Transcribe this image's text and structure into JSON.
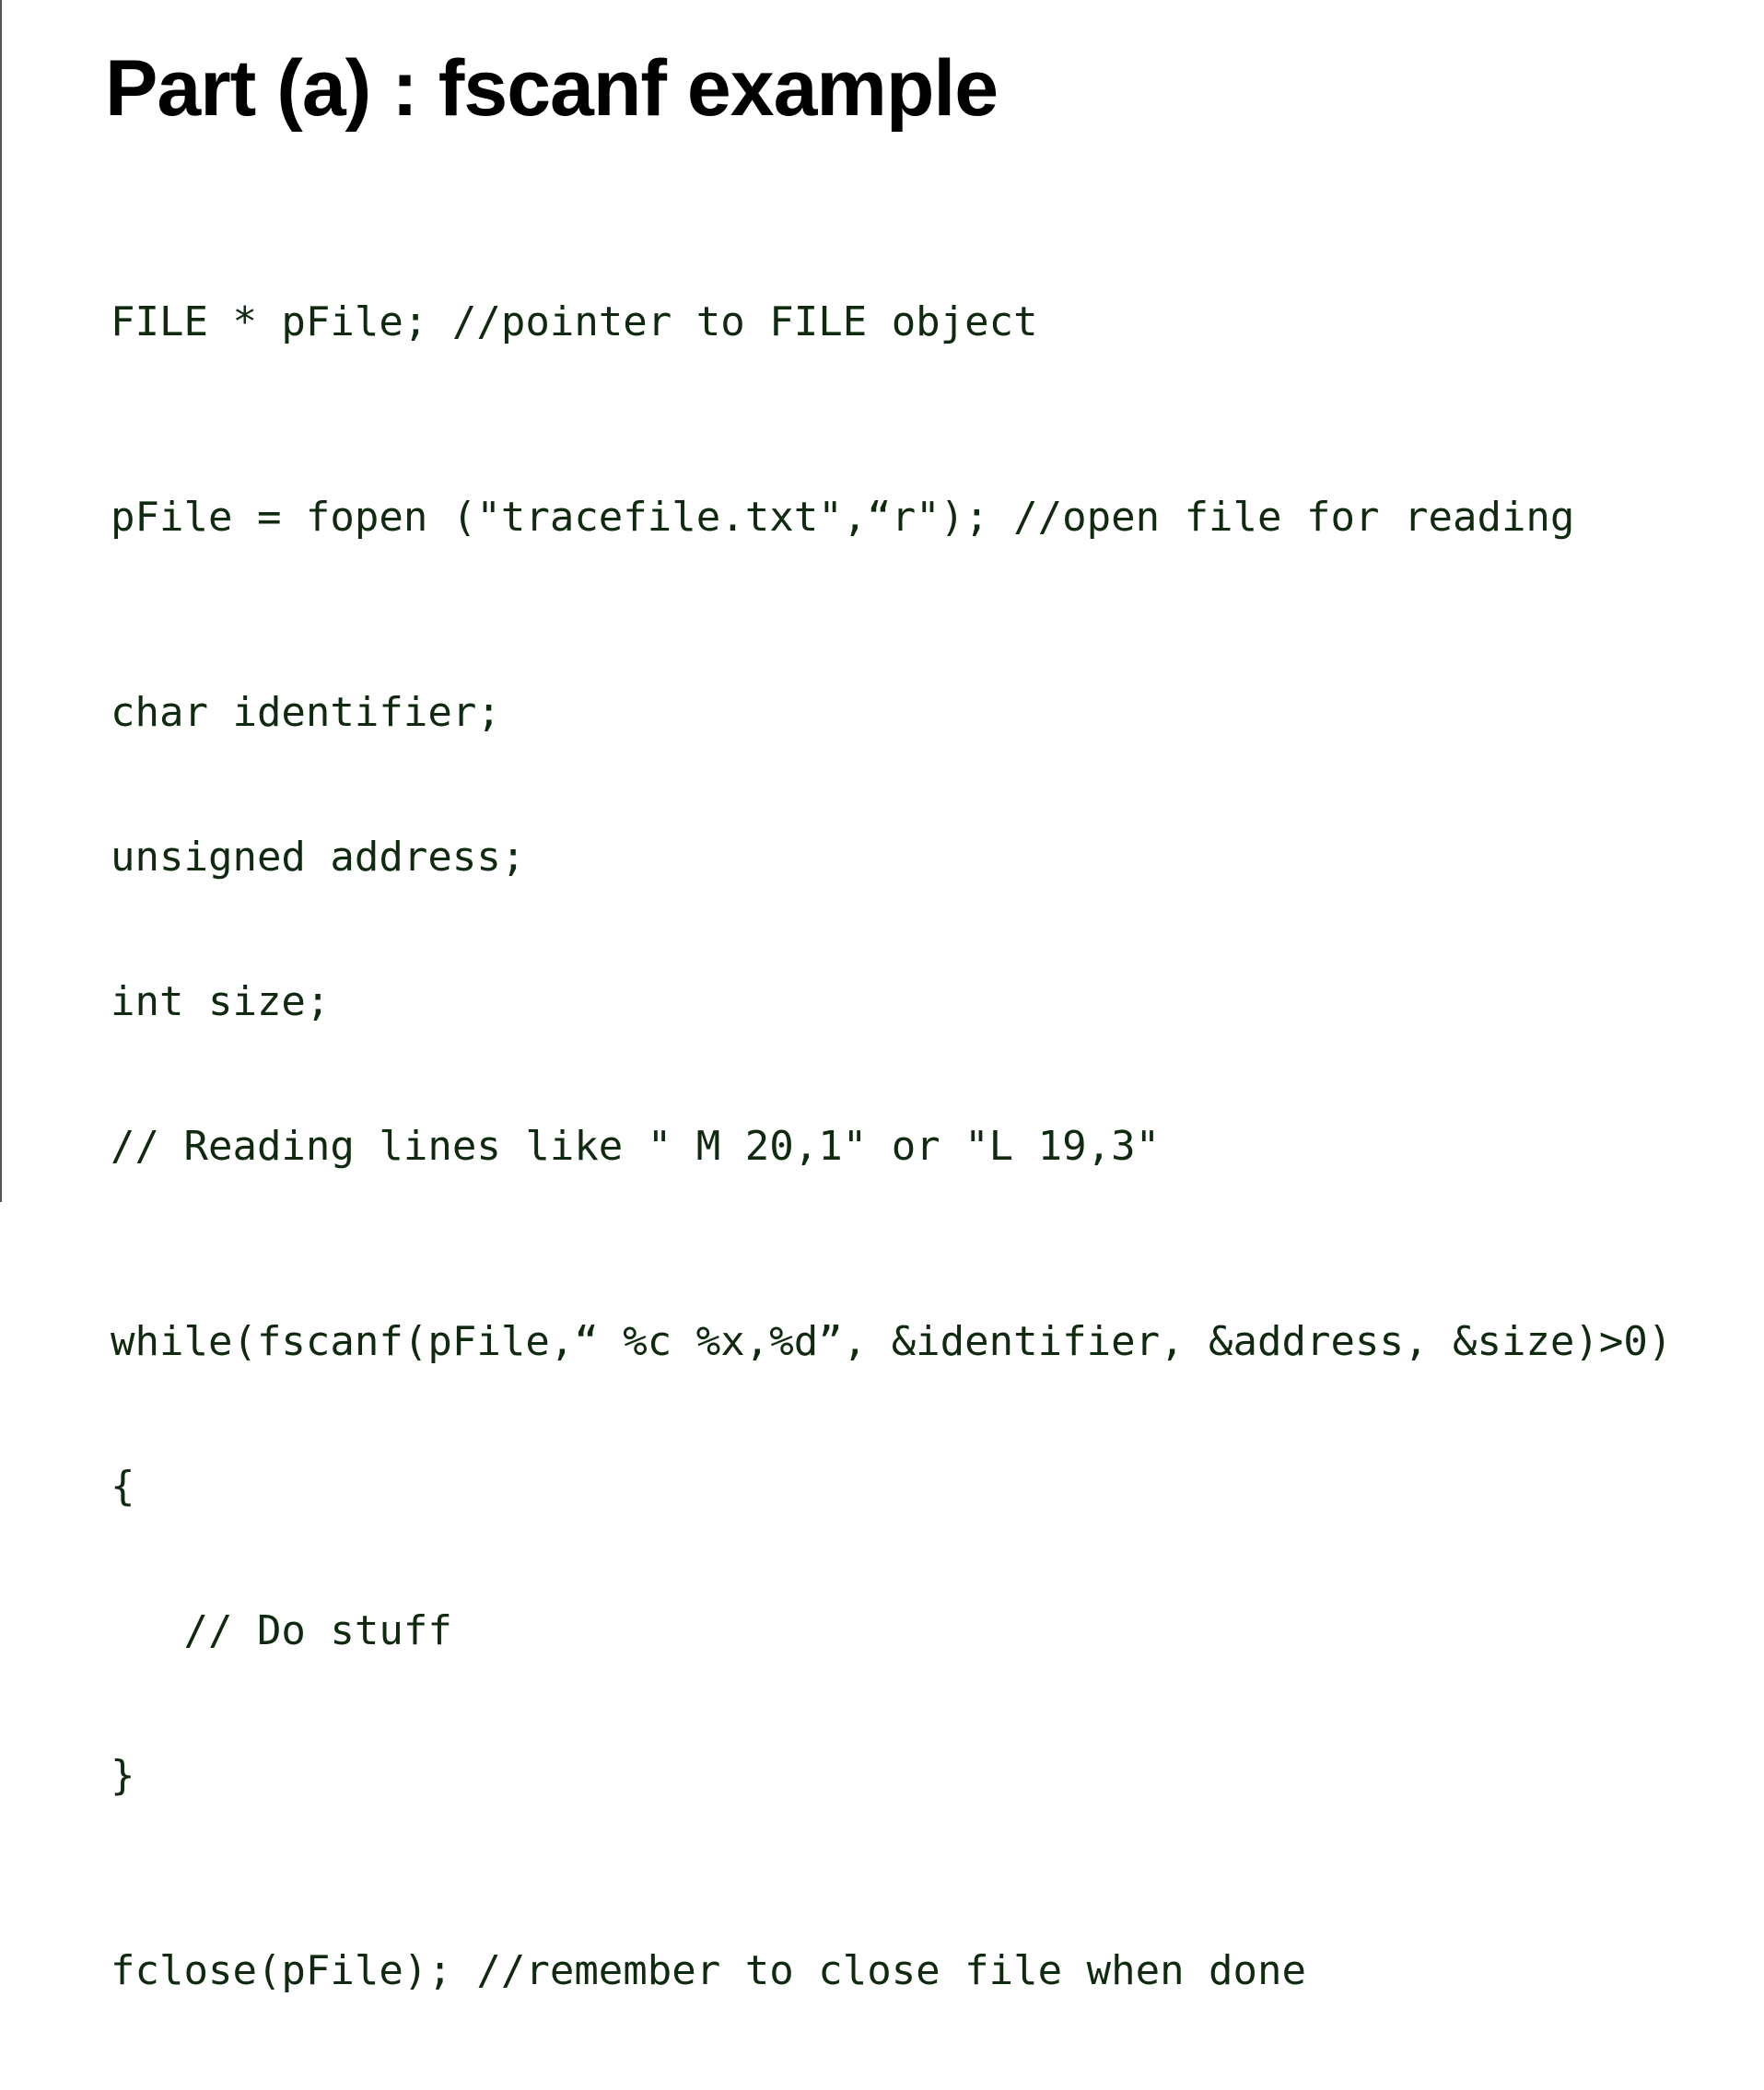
{
  "slide": {
    "title": "Part (a) : fscanf example",
    "code_lines": [
      "FILE * pFile; //pointer to FILE object",
      "pFile = fopen (\"tracefile.txt\",“r\"); //open file for reading",
      "char identifier;",
      "unsigned address;",
      "int size;",
      "// Reading lines like \" M 20,1\" or \"L 19,3\"",
      "while(fscanf(pFile,“ %c %x,%d”, &identifier, &address, &size)>0)",
      "{",
      "   // Do stuff",
      "}",
      "fclose(pFile); //remember to close file when done"
    ]
  }
}
